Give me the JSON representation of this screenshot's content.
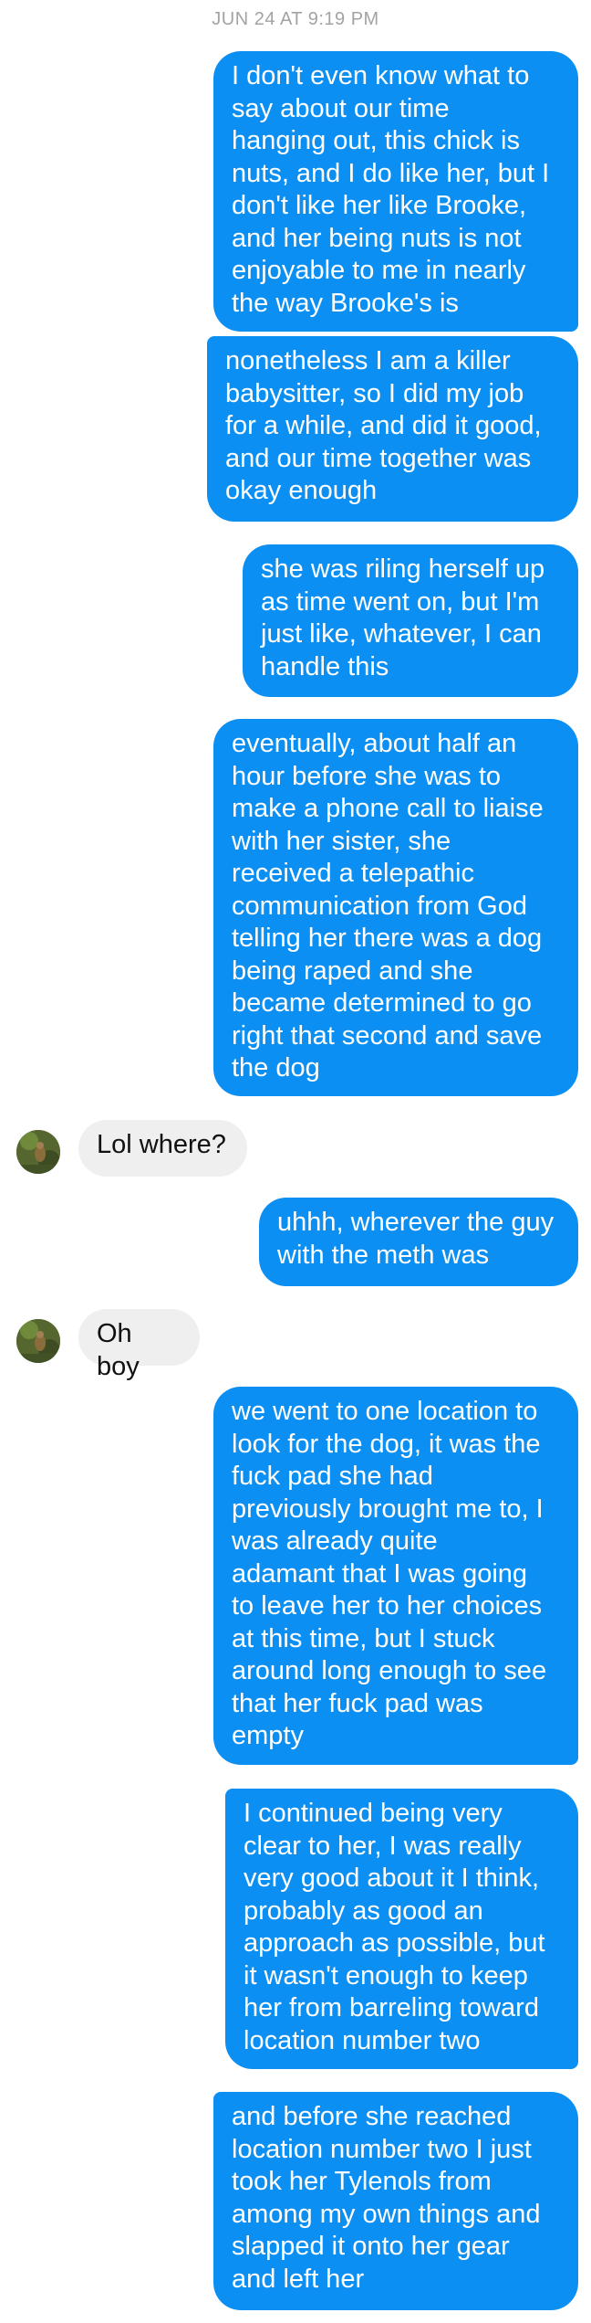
{
  "conversation": {
    "timestamp": "JUN 24 AT 9:19 PM",
    "messages": [
      {
        "sender": "me",
        "text": "I don't even know what to\nsay about our time\nhanging out, this chick is\nnuts, and I do like her, but I\ndon't like her like Brooke,\nand her being nuts is not\nenjoyable to me in nearly\nthe way Brooke's is"
      },
      {
        "sender": "me",
        "text": "nonetheless I am a killer\nbabysitter, so I did my job\nfor a while, and did it good,\nand our time together was\nokay enough"
      },
      {
        "sender": "me",
        "text": "she was riling herself up\nas time went on, but I'm\njust like, whatever, I can\nhandle this"
      },
      {
        "sender": "me",
        "text": "eventually, about half an\nhour before she was to\nmake a phone call to liaise\nwith her sister, she\nreceived a telepathic\ncommunication from God\ntelling her there was a dog\nbeing raped and she\nbecame determined to go\nright that second and save\nthe dog"
      },
      {
        "sender": "them",
        "text": "Lol where?"
      },
      {
        "sender": "me",
        "text": "uhhh, wherever the guy\nwith the meth was"
      },
      {
        "sender": "them",
        "text": "Oh boy"
      },
      {
        "sender": "me",
        "text": "we went to one location to\nlook for the dog, it was the\nfuck pad she had\npreviously brought me to, I\nwas already quite\nadamant that I was going\nto leave her to her choices\nat this time, but I stuck\naround long enough to see\nthat her fuck pad was\nempty"
      },
      {
        "sender": "me",
        "text": "I continued being very\nclear to her, I was really\nvery good about it I think,\nprobably as good an\napproach as possible, but\nit wasn't enough to keep\nher from barreling toward\nlocation number two"
      },
      {
        "sender": "me",
        "text": "and before she reached\nlocation number two I just\ntook her Tylenols from\namong my own things and\nslapped it onto her gear\nand left her"
      }
    ]
  },
  "colors": {
    "outgoing_bubble": "#0c8ff2",
    "incoming_bubble": "#efefef",
    "timestamp_text": "#a3a3a3"
  },
  "icons": {
    "contact_avatar": "contact-avatar-photo"
  }
}
